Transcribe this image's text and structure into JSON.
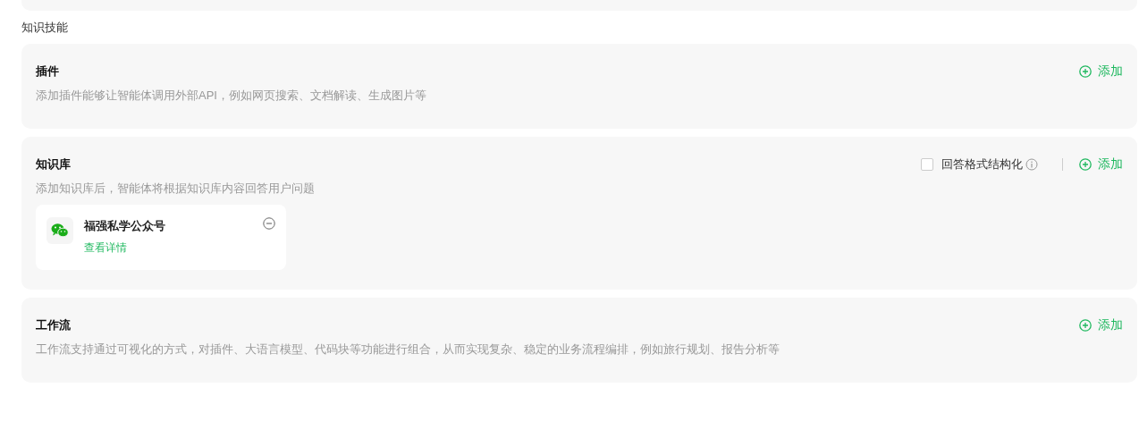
{
  "section_title": "知识技能",
  "cards": [
    {
      "title": "插件",
      "description": "添加插件能够让智能体调用外部API，例如网页搜索、文档解读、生成图片等",
      "add_label": "添加"
    },
    {
      "title": "知识库",
      "description": "添加知识库后，智能体将根据知识库内容回答用户问题",
      "add_label": "添加",
      "option": {
        "label": "回答格式结构化",
        "checked": false
      },
      "items": [
        {
          "name": "福强私学公众号",
          "link": "查看详情"
        }
      ]
    },
    {
      "title": "工作流",
      "description": "工作流支持通过可视化的方式，对插件、大语言模型、代码块等功能进行组合，从而实现复杂、稳定的业务流程编排，例如旅行规划、报告分析等",
      "add_label": "添加"
    }
  ]
}
